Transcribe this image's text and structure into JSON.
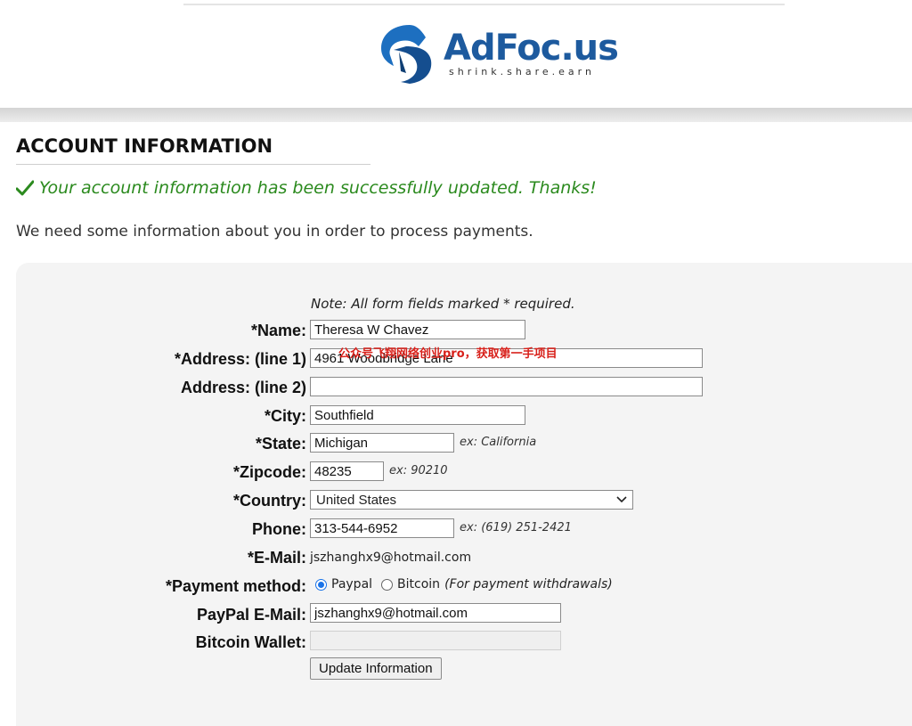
{
  "logo": {
    "brand": "AdFoc.us",
    "tagline": "shrink.share.earn"
  },
  "page": {
    "title": "ACCOUNT INFORMATION",
    "success_message": "Your account information has been successfully updated. Thanks!",
    "intro": "We need some information about you in order to process payments."
  },
  "form": {
    "note": "Note: All form fields marked * required.",
    "name": {
      "label": "*Name:",
      "value": "Theresa W Chavez"
    },
    "address1": {
      "label": "*Address: (line 1)",
      "value": "4961 Woodbridge Lane"
    },
    "address2": {
      "label": "Address: (line 2)",
      "value": ""
    },
    "city": {
      "label": "*City:",
      "value": "Southfield"
    },
    "state": {
      "label": "*State:",
      "value": "Michigan",
      "hint": "ex: California"
    },
    "zipcode": {
      "label": "*Zipcode:",
      "value": "48235",
      "hint": "ex: 90210"
    },
    "country": {
      "label": "*Country:",
      "value": "United States"
    },
    "phone": {
      "label": "Phone:",
      "value": "313-544-6952",
      "hint": "ex: (619) 251-2421"
    },
    "email": {
      "label": "*E-Mail:",
      "value": "jszhanghx9@hotmail.com"
    },
    "payment": {
      "label": "*Payment method:",
      "option_paypal": "Paypal",
      "option_bitcoin": "Bitcoin",
      "selected": "Paypal",
      "note": "(For payment withdrawals)"
    },
    "paypal_email": {
      "label": "PayPal E-Mail:",
      "value": "jszhanghx9@hotmail.com"
    },
    "bitcoin_wallet": {
      "label": "Bitcoin Wallet:",
      "value": ""
    },
    "submit_label": "Update Information"
  },
  "watermark": "公众号飞翔网络创业pro，获取第一手项目",
  "colors": {
    "brand": "#1d5a9e",
    "success": "#2b8a1e",
    "watermark": "#d8201a"
  },
  "icons": {
    "success": "checkmark-icon",
    "logo": "adfocus-logo-icon",
    "select": "chevron-down-icon"
  }
}
